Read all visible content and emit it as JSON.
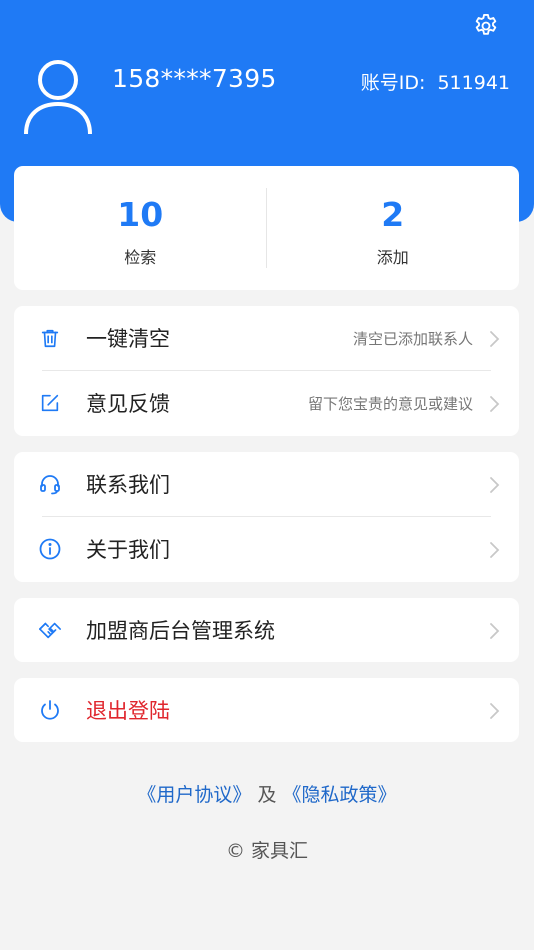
{
  "header": {
    "phone": "158****7395",
    "account_label": "账号ID:",
    "account_id": "511941"
  },
  "stats": [
    {
      "value": "10",
      "label": "检索"
    },
    {
      "value": "2",
      "label": "添加"
    }
  ],
  "menu": {
    "clear": {
      "label": "一键清空",
      "desc": "清空已添加联系人"
    },
    "feedback": {
      "label": "意见反馈",
      "desc": "留下您宝贵的意见或建议"
    },
    "contact": {
      "label": "联系我们"
    },
    "about": {
      "label": "关于我们"
    },
    "franchise": {
      "label": "加盟商后台管理系统"
    },
    "logout": {
      "label": "退出登陆"
    }
  },
  "footer": {
    "user_agreement": "《用户协议》",
    "and": "及",
    "privacy_policy": "《隐私政策》",
    "copyright_symbol": "©",
    "copyright": "家具汇"
  },
  "colors": {
    "accent": "#1f7af5",
    "danger": "#e0262d",
    "background": "#f3f3f3"
  }
}
